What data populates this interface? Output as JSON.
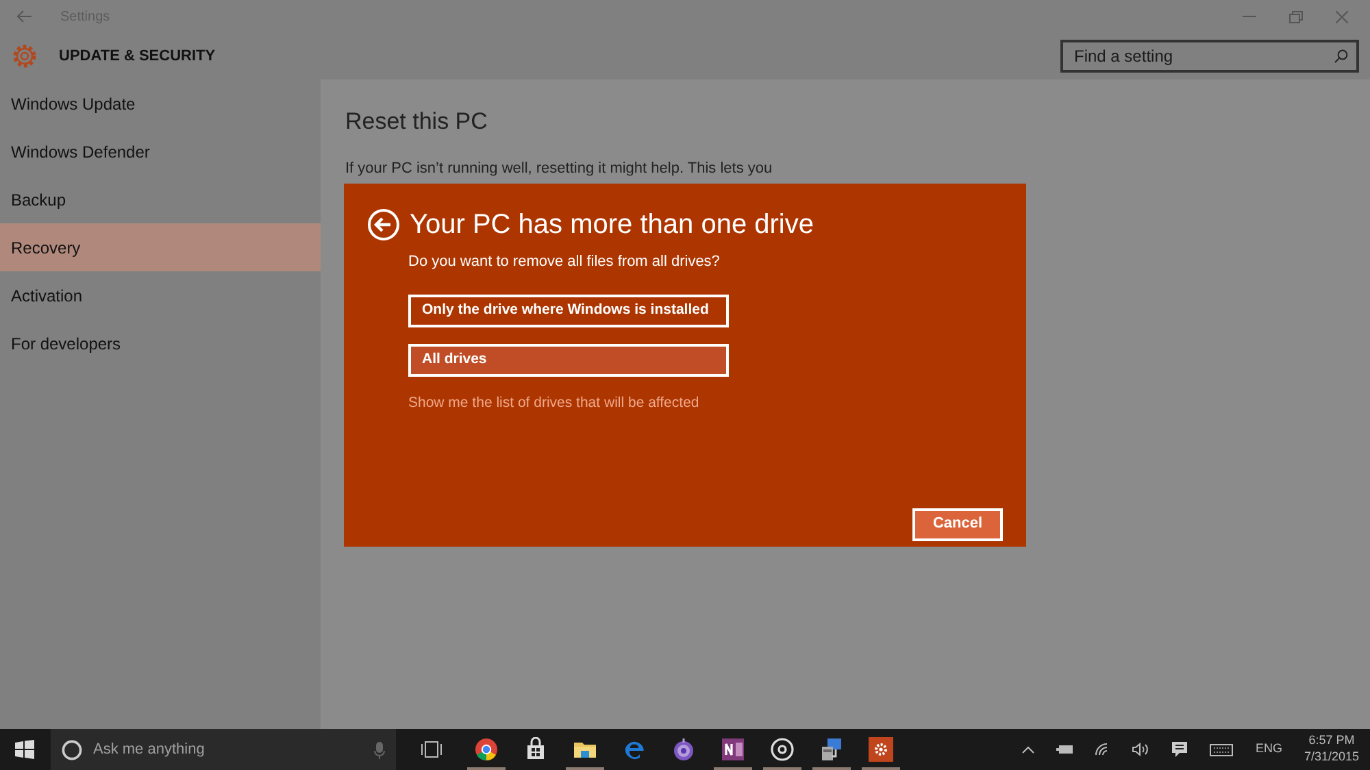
{
  "window": {
    "title": "Settings"
  },
  "header": {
    "title": "UPDATE & SECURITY",
    "search": {
      "placeholder": "Find a setting"
    }
  },
  "sidebar": {
    "items": [
      {
        "label": "Windows Update",
        "selected": false
      },
      {
        "label": "Windows Defender",
        "selected": false
      },
      {
        "label": "Backup",
        "selected": false
      },
      {
        "label": "Recovery",
        "selected": true
      },
      {
        "label": "Activation",
        "selected": false
      },
      {
        "label": "For developers",
        "selected": false
      }
    ]
  },
  "content": {
    "heading": "Reset this PC",
    "paragraph": "If your PC isn’t running well, resetting it might help. This lets you"
  },
  "dialog": {
    "title": "Your PC has more than one drive",
    "question": "Do you want to remove all files from all drives?",
    "options": [
      {
        "label": "Only the drive where Windows is installed",
        "selected": false
      },
      {
        "label": "All drives",
        "selected": true
      }
    ],
    "link": "Show me the list of drives that will be affected",
    "cancel": "Cancel"
  },
  "taskbar": {
    "search": {
      "placeholder": "Ask me anything"
    },
    "apps": [
      {
        "kind": "chrome",
        "running": true
      },
      {
        "kind": "store",
        "running": false
      },
      {
        "kind": "explorer",
        "running": true
      },
      {
        "kind": "edge",
        "running": false
      },
      {
        "kind": "tor",
        "running": false
      },
      {
        "kind": "onenote",
        "running": true
      },
      {
        "kind": "groove",
        "running": true
      },
      {
        "kind": "installer",
        "running": true
      },
      {
        "kind": "settings",
        "running": true
      }
    ],
    "language": "ENG",
    "time": "6:57 PM",
    "date": "7/31/2015"
  }
}
